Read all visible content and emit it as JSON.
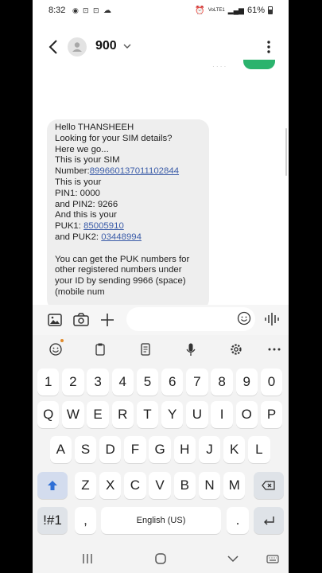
{
  "status_bar": {
    "time": "8:32",
    "battery": "61%",
    "network": "VoLTE1"
  },
  "header": {
    "contact": "900"
  },
  "message": {
    "lines": [
      {
        "text": "Hello THANSHEEH"
      },
      {
        "text": "Looking for your SIM details?"
      },
      {
        "text": "Here we go..."
      },
      {
        "text": "This is your SIM"
      },
      {
        "text": "Number:",
        "link": "899660137011102844"
      },
      {
        "text": "This is your"
      },
      {
        "text": "PIN1: 0000"
      },
      {
        "text": "and PIN2: 9266"
      },
      {
        "text": "And this is your"
      },
      {
        "text": "PUK1: ",
        "link": "85005910"
      },
      {
        "text": "and PUK2: ",
        "link": "03448994"
      },
      {
        "text": ""
      },
      {
        "text": "You can get the PUK numbers for"
      },
      {
        "text": "other registered numbers under"
      },
      {
        "text": "your ID by sending 9966 (space)"
      },
      {
        "text": "(mobile num"
      }
    ]
  },
  "composer": {
    "placeholder": ""
  },
  "keyboard": {
    "numbers": [
      "1",
      "2",
      "3",
      "4",
      "5",
      "6",
      "7",
      "8",
      "9",
      "0"
    ],
    "row1": [
      "Q",
      "W",
      "E",
      "R",
      "T",
      "Y",
      "U",
      "I",
      "O",
      "P"
    ],
    "row2": [
      "A",
      "S",
      "D",
      "F",
      "G",
      "H",
      "J",
      "K",
      "L"
    ],
    "row3": [
      "Z",
      "X",
      "C",
      "V",
      "B",
      "N",
      "M"
    ],
    "symbols_key": "!#1",
    "comma_key": ",",
    "space_label": "English (US)",
    "period_key": "."
  }
}
